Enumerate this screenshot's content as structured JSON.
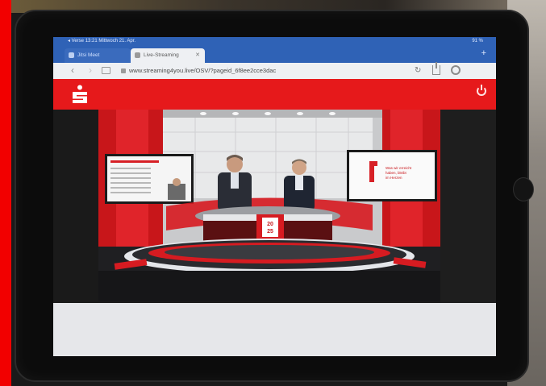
{
  "status_bar": {
    "time_left": "◂ Verse  13:21  Mittwoch 21. Apr.",
    "battery": "91 %"
  },
  "tabs": [
    {
      "label": "Jitsi Meet"
    },
    {
      "label": "Live-Streaming"
    }
  ],
  "address_bar": {
    "url": "www.streaming4you.live/OSV/?pageid_6f8ee2cce3dac"
  },
  "video": {
    "desk_badge_line1": "20",
    "desk_badge_line2": "25",
    "right_monitor_text": "Was wir erreicht haben, bleibt im Herzen"
  },
  "colors": {
    "brand_red": "#e6191b",
    "browser_blue": "#2f62b6",
    "browser_toolbar": "#eef0f3"
  },
  "icons": [
    "sparkasse-logo",
    "power-icon",
    "lock-icon",
    "reload-icon",
    "share-icon",
    "settings-icon",
    "reader-icon"
  ]
}
